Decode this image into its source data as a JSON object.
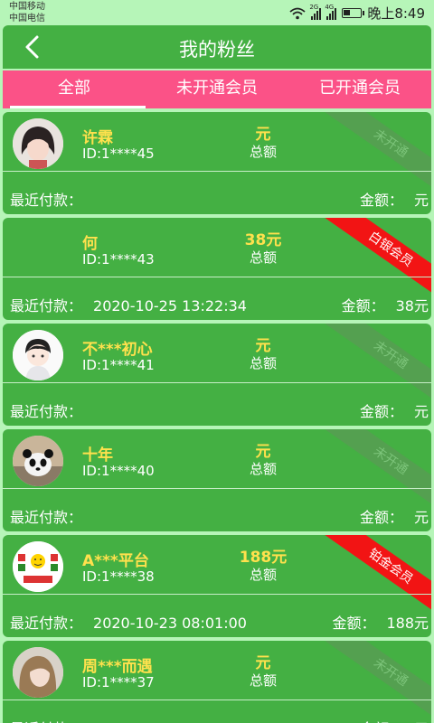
{
  "status_bar": {
    "carrier1": "中国移动",
    "carrier2": "中国电信",
    "signal1_tag": "2G",
    "signal2_tag": "4G",
    "time": "晚上8:49"
  },
  "header": {
    "title": "我的粉丝"
  },
  "tabs": [
    {
      "label": "全部",
      "active": true
    },
    {
      "label": "未开通会员",
      "active": false
    },
    {
      "label": "已开通会员",
      "active": false
    }
  ],
  "labels": {
    "total": "总额",
    "recent": "最近付款：",
    "amount": "金额："
  },
  "fans": [
    {
      "name": "许霖",
      "id": "ID:1****45",
      "amount": "元",
      "recent_date": "",
      "paid": "元",
      "badge": "未开通",
      "badge_type": "none",
      "avatar": "girl-avatar"
    },
    {
      "name": "何",
      "id": "ID:1****43",
      "amount": "38元",
      "recent_date": "2020-10-25 13:22:34",
      "paid": "38元",
      "badge": "白银会员",
      "badge_type": "vip",
      "avatar": "blank-avatar"
    },
    {
      "name": "不***初心",
      "id": "ID:1****41",
      "amount": "元",
      "recent_date": "",
      "paid": "元",
      "badge": "未开通",
      "badge_type": "none",
      "avatar": "cartoon-boy-avatar"
    },
    {
      "name": "十年",
      "id": "ID:1****40",
      "amount": "元",
      "recent_date": "",
      "paid": "元",
      "badge": "未开通",
      "badge_type": "none",
      "avatar": "panda-avatar"
    },
    {
      "name": "A***平台",
      "id": "ID:1****38",
      "amount": "188元",
      "recent_date": "2020-10-23 08:01:00",
      "paid": "188元",
      "badge": "铂金会员",
      "badge_type": "vip",
      "avatar": "shop-logo-avatar"
    },
    {
      "name": "周***而遇",
      "id": "ID:1****37",
      "amount": "元",
      "recent_date": "",
      "paid": "元",
      "badge": "未开通",
      "badge_type": "none",
      "avatar": "woman-avatar"
    }
  ],
  "colors": {
    "card": "#44b043",
    "tab_bar": "#fb5287",
    "highlight": "#ffe14d",
    "vip_ribbon": "#f21414"
  }
}
